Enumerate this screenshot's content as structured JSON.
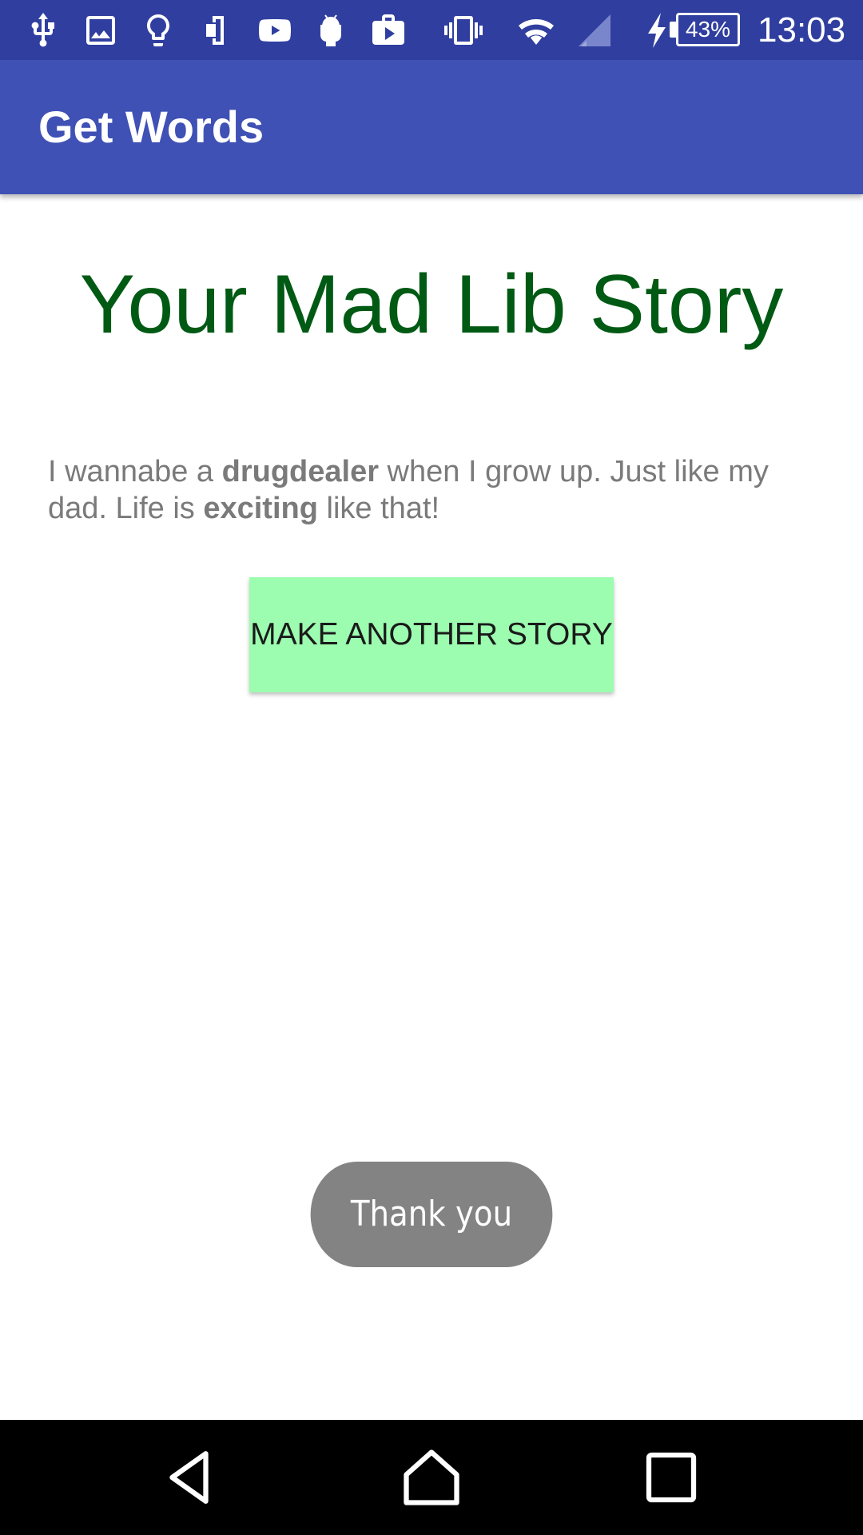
{
  "status_bar": {
    "icons": [
      "usb-icon",
      "image-icon",
      "lightbulb-icon",
      "phone-sync-icon",
      "youtube-icon",
      "android-icon",
      "briefcase-play-icon",
      "vibrate-icon",
      "wifi-icon",
      "signal-icon",
      "charging-icon"
    ],
    "battery_percent": "43%",
    "time": "13:03"
  },
  "app_bar": {
    "title": "Get Words"
  },
  "main": {
    "heading": "Your Mad Lib Story",
    "story": {
      "part1": "I wannabe a ",
      "word1": "drugdealer",
      "part2": " when I grow up. Just like my dad. Life is ",
      "word2": "exciting",
      "part3": " like that!"
    },
    "make_another_label": "MAKE ANOTHER STORY"
  },
  "toast": {
    "message": "Thank you"
  },
  "nav_bar": {
    "buttons": [
      "back-icon",
      "home-icon",
      "recents-icon"
    ]
  },
  "colors": {
    "status_bar": "#303f9f",
    "app_bar": "#3f51b5",
    "heading": "#005a14",
    "story_text": "#7a7a7a",
    "button_bg": "#9cfcb0",
    "toast_bg": "#838383"
  }
}
